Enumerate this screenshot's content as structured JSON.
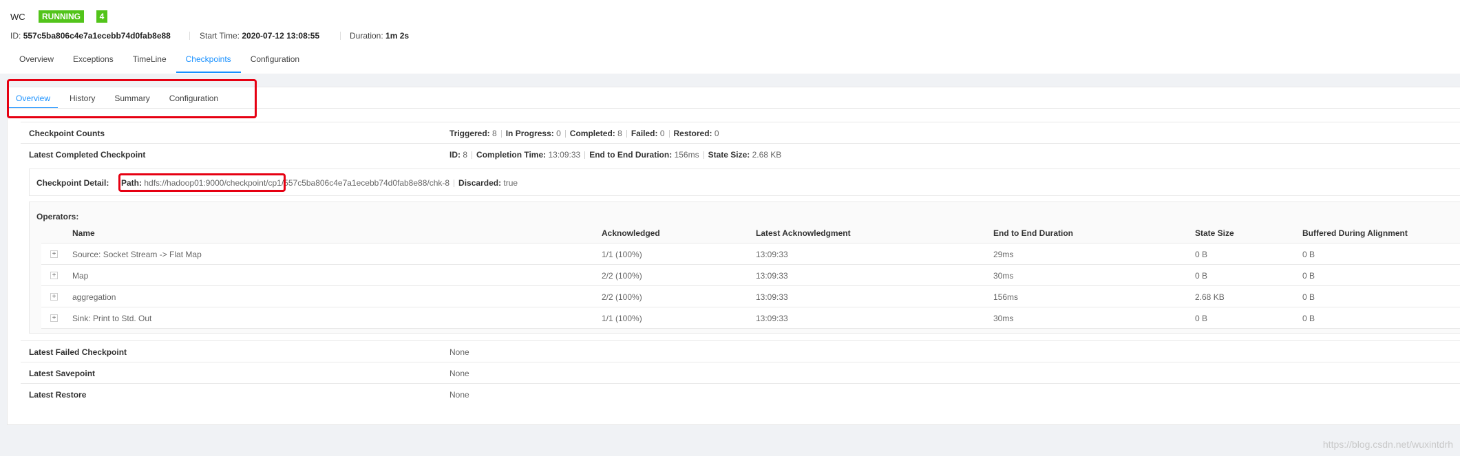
{
  "header": {
    "job_name": "WC",
    "status": "RUNNING",
    "status_count": "4",
    "id_label": "ID:",
    "id_value": "557c5ba806c4e7a1ecebb74d0fab8e88",
    "start_label": "Start Time:",
    "start_value": "2020-07-12 13:08:55",
    "duration_label": "Duration:",
    "duration_value": "1m 2s"
  },
  "top_tabs": [
    "Overview",
    "Exceptions",
    "TimeLine",
    "Checkpoints",
    "Configuration"
  ],
  "sub_tabs": [
    "Overview",
    "History",
    "Summary",
    "Configuration"
  ],
  "counts": {
    "label": "Checkpoint Counts",
    "triggered_label": "Triggered:",
    "triggered": "8",
    "in_progress_label": "In Progress:",
    "in_progress": "0",
    "completed_label": "Completed:",
    "completed": "8",
    "failed_label": "Failed:",
    "failed": "0",
    "restored_label": "Restored:",
    "restored": "0"
  },
  "latest_completed": {
    "label": "Latest Completed Checkpoint",
    "id_label": "ID:",
    "id": "8",
    "completion_label": "Completion Time:",
    "completion": "13:09:33",
    "e2e_label": "End to End Duration:",
    "e2e": "156ms",
    "size_label": "State Size:",
    "size": "2.68 KB"
  },
  "detail": {
    "label": "Checkpoint Detail:",
    "path_label": "Path:",
    "path": "hdfs://hadoop01:9000/checkpoint/cp1/557c5ba806c4e7a1ecebb74d0fab8e88/chk-8",
    "discarded_label": "Discarded:",
    "discarded": "true"
  },
  "operators": {
    "label": "Operators:",
    "columns": [
      "Name",
      "Acknowledged",
      "Latest Acknowledgment",
      "End to End Duration",
      "State Size",
      "Buffered During Alignment"
    ],
    "rows": [
      {
        "expand": "+",
        "name": "Source: Socket Stream -> Flat Map",
        "ack": "1/1 (100%)",
        "latest": "13:09:33",
        "e2e": "29ms",
        "size": "0 B",
        "buffered": "0 B"
      },
      {
        "expand": "+",
        "name": "Map",
        "ack": "2/2 (100%)",
        "latest": "13:09:33",
        "e2e": "30ms",
        "size": "0 B",
        "buffered": "0 B"
      },
      {
        "expand": "+",
        "name": "aggregation",
        "ack": "2/2 (100%)",
        "latest": "13:09:33",
        "e2e": "156ms",
        "size": "2.68 KB",
        "buffered": "0 B"
      },
      {
        "expand": "+",
        "name": "Sink: Print to Std. Out",
        "ack": "1/1 (100%)",
        "latest": "13:09:33",
        "e2e": "30ms",
        "size": "0 B",
        "buffered": "0 B"
      }
    ]
  },
  "latest_failed": {
    "label": "Latest Failed Checkpoint",
    "value": "None"
  },
  "latest_savepoint": {
    "label": "Latest Savepoint",
    "value": "None"
  },
  "latest_restore": {
    "label": "Latest Restore",
    "value": "None"
  },
  "watermark": "https://blog.csdn.net/wuxintdrh",
  "colors": {
    "accent": "#1890ff",
    "running": "#52c41a",
    "highlight": "#e60012"
  }
}
